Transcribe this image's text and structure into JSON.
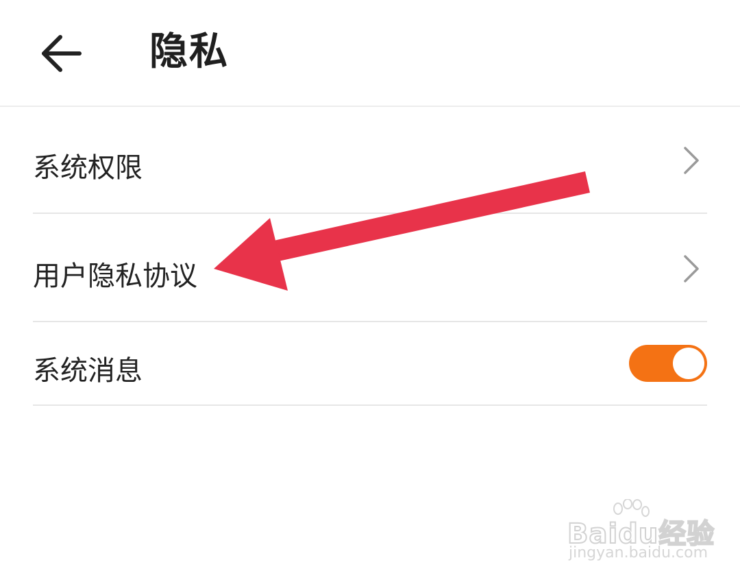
{
  "header": {
    "back_icon": "arrow-left-icon",
    "title": "隐私"
  },
  "settings": {
    "items": [
      {
        "label": "系统权限",
        "control": "chevron-right-icon"
      },
      {
        "label": "用户隐私协议",
        "control": "chevron-right-icon"
      },
      {
        "label": "系统消息",
        "control": "toggle",
        "toggle_on": true
      }
    ]
  },
  "annotation": {
    "type": "arrow",
    "color": "#e8334a",
    "points_to": "用户隐私协议"
  },
  "watermark": {
    "brand": "Baidu经验",
    "url": "jingyan.baidu.com"
  },
  "colors": {
    "toggle_on": "#f47214",
    "divider": "#e6e6e6",
    "chevron": "#9a9a9a"
  }
}
